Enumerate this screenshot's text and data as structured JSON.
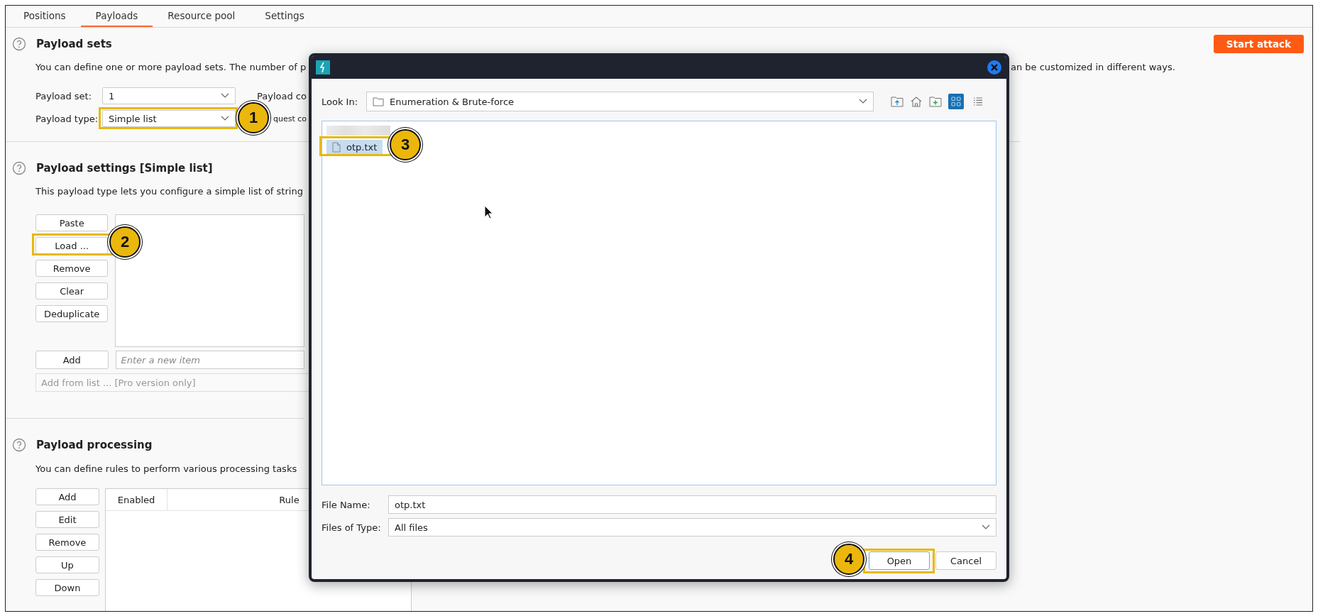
{
  "tabs": [
    {
      "label": "Positions",
      "selected": false
    },
    {
      "label": "Payloads",
      "selected": true
    },
    {
      "label": "Resource pool",
      "selected": false
    },
    {
      "label": "Settings",
      "selected": false
    }
  ],
  "start_button": "Start attack",
  "payload_sets": {
    "title": "Payload sets",
    "description": "You can define one or more payload sets. The number of p",
    "description_after_dialog": "an be customized in different ways.",
    "payload_set": {
      "label": "Payload set:",
      "value": "1"
    },
    "payload_type": {
      "label": "Payload type:",
      "value": "Simple list"
    },
    "payload_count_label": "Payload co",
    "request_count_label": "quest co"
  },
  "payload_settings": {
    "title": "Payload settings [Simple list]",
    "description": "This payload type lets you configure a simple list of string",
    "buttons": [
      "Paste",
      "Load ...",
      "Remove",
      "Clear",
      "Deduplicate"
    ],
    "add_button": "Add",
    "new_item": {
      "placeholder": "Enter a new item"
    },
    "add_from_list": {
      "value": "Add from list ... [Pro version only]",
      "disabled": true
    }
  },
  "payload_processing": {
    "title": "Payload processing",
    "description": "You can define rules to perform various processing tasks",
    "buttons": [
      "Add",
      "Edit",
      "Remove",
      "Up",
      "Down"
    ],
    "table": {
      "columns": [
        "Enabled",
        "Rule"
      ]
    }
  },
  "dialog": {
    "look_in": {
      "label": "Look In:",
      "value": "Enumeration & Brute-force"
    },
    "view_modes": [
      {
        "kind": "grid",
        "selected": true
      },
      {
        "kind": "list",
        "selected": false
      }
    ],
    "files": [
      {
        "kind": "blurred"
      },
      {
        "kind": "file",
        "name": "otp.txt",
        "selected": true
      }
    ],
    "file_name": {
      "label": "File Name:",
      "value": "otp.txt"
    },
    "files_of_type": {
      "label": "Files of Type:",
      "value": "All files"
    },
    "buttons": [
      {
        "label": "Open",
        "focused": true
      },
      {
        "label": "Cancel",
        "focused": false
      }
    ]
  },
  "annotations": [
    {
      "label": "1"
    },
    {
      "label": "2"
    },
    {
      "label": "3"
    },
    {
      "label": "4"
    }
  ]
}
